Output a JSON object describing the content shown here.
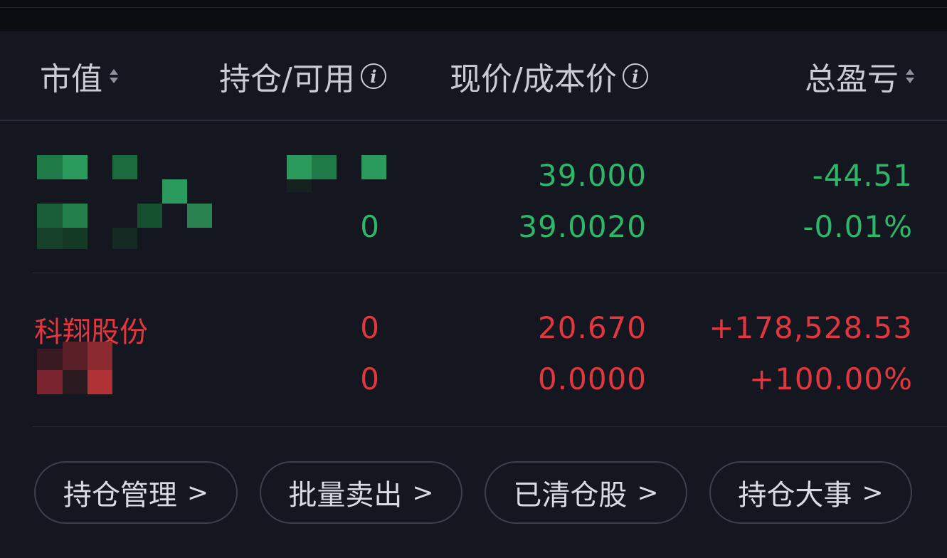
{
  "header": {
    "col_market_value": "市值",
    "col_position": "持仓/可用",
    "col_price": "现价/成本价",
    "col_pnl": "总盈亏"
  },
  "icons": {
    "sort": "sort-icon",
    "info": "info-icon",
    "chevron": "chevron-right-icon"
  },
  "colors": {
    "up": "#e2373e",
    "down": "#2fb769",
    "background": "#141720"
  },
  "positions": [
    {
      "name": "",
      "name_redacted": true,
      "holding": "",
      "holding_redacted": true,
      "available": "0",
      "current_price": "39.000",
      "cost_price": "39.0020",
      "total_pnl": "-44.51",
      "total_pnl_pct": "-0.01%",
      "trend": "down"
    },
    {
      "name": "科翔股份",
      "name_redacted": false,
      "market_value_redacted": true,
      "holding": "0",
      "available": "0",
      "current_price": "20.670",
      "cost_price": "0.0000",
      "total_pnl": "+178,528.53",
      "total_pnl_pct": "+100.00%",
      "trend": "up"
    }
  ],
  "actions": {
    "manage": "持仓管理",
    "batch_sell": "批量卖出",
    "cleared": "已清仓股",
    "events": "持仓大事",
    "chevron": ">"
  }
}
